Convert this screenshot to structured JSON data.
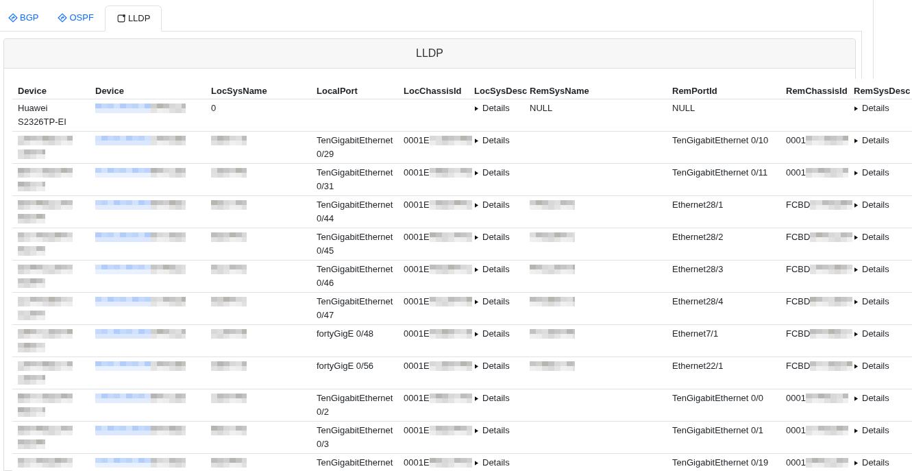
{
  "tabs": [
    {
      "label": "BGP",
      "kind": "routing",
      "selected": false
    },
    {
      "label": "OSPF",
      "kind": "routing",
      "selected": false
    },
    {
      "label": "LLDP",
      "kind": "link-layer",
      "selected": true
    }
  ],
  "panel": {
    "title": "LLDP"
  },
  "table": {
    "columns": [
      "Device",
      "Device",
      "LocSysName",
      "LocalPort",
      "LocChassisId",
      "LocSysDesc",
      "RemSysName",
      "RemPortId",
      "RemChassisId",
      "RemSysDesc"
    ],
    "rows": [
      {
        "cells": [
          {
            "kind": "text",
            "text": "Huawei S2326TP-EI",
            "redacted": false
          },
          {
            "kind": "link",
            "redacted": true
          },
          {
            "kind": "text",
            "text": "0",
            "redacted": false
          },
          {
            "kind": "text",
            "redacted": false
          },
          {
            "kind": "text",
            "redacted": false
          },
          {
            "kind": "details",
            "label": "Details",
            "expanded": false
          },
          {
            "kind": "text",
            "text": "NULL",
            "redacted": false
          },
          {
            "kind": "text",
            "text": "NULL",
            "redacted": false
          },
          {
            "kind": "text",
            "redacted": false
          },
          {
            "kind": "details",
            "label": "Details",
            "expanded": false
          }
        ]
      },
      {
        "cells": [
          {
            "kind": "text",
            "redacted": true
          },
          {
            "kind": "link",
            "redacted": true
          },
          {
            "kind": "text",
            "redacted": true
          },
          {
            "kind": "text",
            "text": "TenGigabitEthernet 0/29",
            "redacted": false
          },
          {
            "kind": "text",
            "text": "0001E",
            "redacted": true
          },
          {
            "kind": "details",
            "label": "Details",
            "expanded": false
          },
          {
            "kind": "text",
            "redacted": false
          },
          {
            "kind": "text",
            "text": "TenGigabitEthernet 0/10",
            "redacted": false
          },
          {
            "kind": "text",
            "text": "0001",
            "redacted": true
          },
          {
            "kind": "details",
            "label": "Details",
            "expanded": false
          }
        ]
      },
      {
        "cells": [
          {
            "kind": "text",
            "redacted": true
          },
          {
            "kind": "link",
            "redacted": true
          },
          {
            "kind": "text",
            "redacted": true
          },
          {
            "kind": "text",
            "text": "TenGigabitEthernet 0/31",
            "redacted": false
          },
          {
            "kind": "text",
            "text": "0001E",
            "redacted": true
          },
          {
            "kind": "details",
            "label": "Details",
            "expanded": false
          },
          {
            "kind": "text",
            "redacted": false
          },
          {
            "kind": "text",
            "text": "TenGigabitEthernet 0/11",
            "redacted": false
          },
          {
            "kind": "text",
            "text": "0001",
            "redacted": true
          },
          {
            "kind": "details",
            "label": "Details",
            "expanded": false
          }
        ]
      },
      {
        "cells": [
          {
            "kind": "text",
            "redacted": true
          },
          {
            "kind": "link",
            "redacted": true
          },
          {
            "kind": "text",
            "redacted": true
          },
          {
            "kind": "text",
            "text": "TenGigabitEthernet 0/44",
            "redacted": false
          },
          {
            "kind": "text",
            "text": "0001E",
            "redacted": true
          },
          {
            "kind": "details",
            "label": "Details",
            "expanded": false
          },
          {
            "kind": "text",
            "redacted": true
          },
          {
            "kind": "text",
            "text": "Ethernet28/1",
            "redacted": false
          },
          {
            "kind": "text",
            "text": "FCBD",
            "redacted": true
          },
          {
            "kind": "details",
            "label": "Details",
            "expanded": false
          }
        ]
      },
      {
        "cells": [
          {
            "kind": "text",
            "redacted": true
          },
          {
            "kind": "link",
            "redacted": true
          },
          {
            "kind": "text",
            "redacted": true
          },
          {
            "kind": "text",
            "text": "TenGigabitEthernet 0/45",
            "redacted": false
          },
          {
            "kind": "text",
            "text": "0001E",
            "redacted": true
          },
          {
            "kind": "details",
            "label": "Details",
            "expanded": false
          },
          {
            "kind": "text",
            "redacted": true
          },
          {
            "kind": "text",
            "text": "Ethernet28/2",
            "redacted": false
          },
          {
            "kind": "text",
            "text": "FCBD",
            "redacted": true
          },
          {
            "kind": "details",
            "label": "Details",
            "expanded": false
          }
        ]
      },
      {
        "cells": [
          {
            "kind": "text",
            "redacted": true
          },
          {
            "kind": "link",
            "redacted": true
          },
          {
            "kind": "text",
            "redacted": true
          },
          {
            "kind": "text",
            "text": "TenGigabitEthernet 0/46",
            "redacted": false
          },
          {
            "kind": "text",
            "text": "0001E",
            "redacted": true
          },
          {
            "kind": "details",
            "label": "Details",
            "expanded": false
          },
          {
            "kind": "text",
            "redacted": true
          },
          {
            "kind": "text",
            "text": "Ethernet28/3",
            "redacted": false
          },
          {
            "kind": "text",
            "text": "FCBD",
            "redacted": true
          },
          {
            "kind": "details",
            "label": "Details",
            "expanded": false
          }
        ]
      },
      {
        "cells": [
          {
            "kind": "text",
            "redacted": true
          },
          {
            "kind": "link",
            "redacted": true
          },
          {
            "kind": "text",
            "redacted": true
          },
          {
            "kind": "text",
            "text": "TenGigabitEthernet 0/47",
            "redacted": false
          },
          {
            "kind": "text",
            "text": "0001E",
            "redacted": true
          },
          {
            "kind": "details",
            "label": "Details",
            "expanded": false
          },
          {
            "kind": "text",
            "redacted": true
          },
          {
            "kind": "text",
            "text": "Ethernet28/4",
            "redacted": false
          },
          {
            "kind": "text",
            "text": "FCBD",
            "redacted": true
          },
          {
            "kind": "details",
            "label": "Details",
            "expanded": false
          }
        ]
      },
      {
        "cells": [
          {
            "kind": "text",
            "redacted": true
          },
          {
            "kind": "link",
            "redacted": true
          },
          {
            "kind": "text",
            "redacted": true
          },
          {
            "kind": "text",
            "text": "fortyGigE 0/48",
            "redacted": false
          },
          {
            "kind": "text",
            "text": "0001E",
            "redacted": true
          },
          {
            "kind": "details",
            "label": "Details",
            "expanded": false
          },
          {
            "kind": "text",
            "redacted": true
          },
          {
            "kind": "text",
            "text": "Ethernet7/1",
            "redacted": false
          },
          {
            "kind": "text",
            "text": "FCBD",
            "redacted": true
          },
          {
            "kind": "details",
            "label": "Details",
            "expanded": false
          }
        ]
      },
      {
        "cells": [
          {
            "kind": "text",
            "redacted": true
          },
          {
            "kind": "link",
            "redacted": true
          },
          {
            "kind": "text",
            "redacted": true
          },
          {
            "kind": "text",
            "text": "fortyGigE 0/56",
            "redacted": false
          },
          {
            "kind": "text",
            "text": "0001E",
            "redacted": true
          },
          {
            "kind": "details",
            "label": "Details",
            "expanded": false
          },
          {
            "kind": "text",
            "redacted": true
          },
          {
            "kind": "text",
            "text": "Ethernet22/1",
            "redacted": false
          },
          {
            "kind": "text",
            "text": "FCBD",
            "redacted": true
          },
          {
            "kind": "details",
            "label": "Details",
            "expanded": false
          }
        ]
      },
      {
        "cells": [
          {
            "kind": "text",
            "redacted": true
          },
          {
            "kind": "link",
            "redacted": true
          },
          {
            "kind": "text",
            "redacted": true
          },
          {
            "kind": "text",
            "text": "TenGigabitEthernet 0/2",
            "redacted": false
          },
          {
            "kind": "text",
            "text": "0001E",
            "redacted": true
          },
          {
            "kind": "details",
            "label": "Details",
            "expanded": false
          },
          {
            "kind": "text",
            "redacted": false
          },
          {
            "kind": "text",
            "text": "TenGigabitEthernet 0/0",
            "redacted": false
          },
          {
            "kind": "text",
            "text": "0001",
            "redacted": true
          },
          {
            "kind": "details",
            "label": "Details",
            "expanded": false
          }
        ]
      },
      {
        "cells": [
          {
            "kind": "text",
            "redacted": true
          },
          {
            "kind": "link",
            "redacted": true
          },
          {
            "kind": "text",
            "redacted": true
          },
          {
            "kind": "text",
            "text": "TenGigabitEthernet 0/3",
            "redacted": false
          },
          {
            "kind": "text",
            "text": "0001E",
            "redacted": true
          },
          {
            "kind": "details",
            "label": "Details",
            "expanded": false
          },
          {
            "kind": "text",
            "redacted": false
          },
          {
            "kind": "text",
            "text": "TenGigabitEthernet 0/1",
            "redacted": false
          },
          {
            "kind": "text",
            "text": "0001",
            "redacted": true
          },
          {
            "kind": "details",
            "label": "Details",
            "expanded": false
          }
        ]
      },
      {
        "cells": [
          {
            "kind": "text",
            "redacted": true
          },
          {
            "kind": "link",
            "redacted": true
          },
          {
            "kind": "text",
            "redacted": true
          },
          {
            "kind": "text",
            "text": "TenGigabitEthernet",
            "redacted": false
          },
          {
            "kind": "text",
            "text": "0001E",
            "redacted": true
          },
          {
            "kind": "details",
            "label": "Details",
            "expanded": false
          },
          {
            "kind": "text",
            "redacted": false
          },
          {
            "kind": "text",
            "text": "TenGigabitEthernet 0/19",
            "redacted": false
          },
          {
            "kind": "text",
            "text": "0001",
            "redacted": true
          },
          {
            "kind": "details",
            "label": "Details",
            "expanded": false
          }
        ]
      }
    ]
  }
}
